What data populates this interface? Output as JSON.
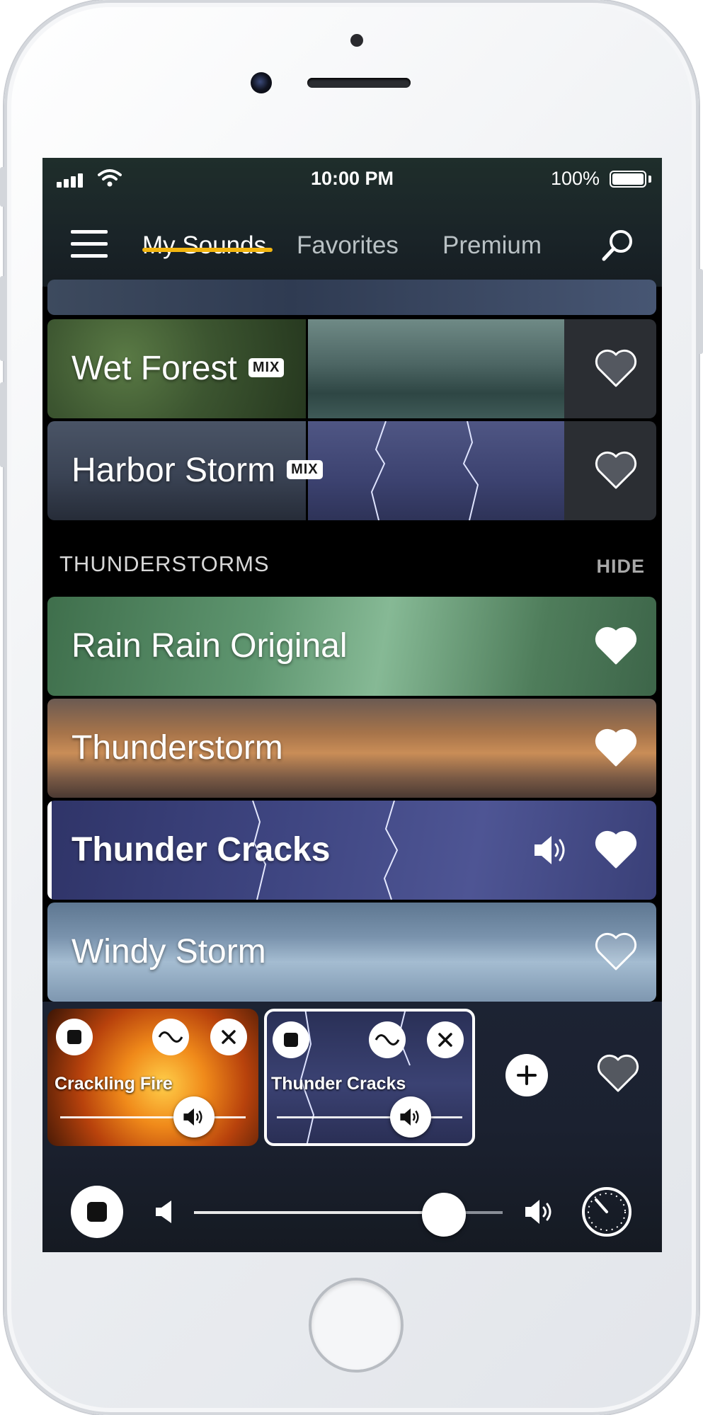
{
  "status": {
    "time": "10:00 PM",
    "battery": "100%"
  },
  "nav": {
    "tabs": [
      {
        "label": "My Sounds",
        "active": true
      },
      {
        "label": "Favorites",
        "active": false
      },
      {
        "label": "Premium",
        "active": false
      }
    ],
    "accent": "#f1b510"
  },
  "mixes": [
    {
      "title": "Wet Forest",
      "badge": "MIX"
    },
    {
      "title": "Harbor Storm",
      "badge": "MIX"
    }
  ],
  "section": {
    "title": "THUNDERSTORMS",
    "action": "HIDE"
  },
  "sounds": [
    {
      "title": "Rain Rain Original",
      "favorite": true,
      "playing": false
    },
    {
      "title": "Thunderstorm",
      "favorite": true,
      "playing": false
    },
    {
      "title": "Thunder Cracks",
      "favorite": true,
      "playing": true
    },
    {
      "title": "Windy Storm",
      "favorite": false,
      "playing": false
    }
  ],
  "mixer": {
    "tracks": [
      {
        "label": "Crackling Fire",
        "volume": 0.72
      },
      {
        "label": "Thunder Cracks",
        "volume": 0.72
      }
    ],
    "master_volume": 0.81
  },
  "icons": [
    "menu-icon",
    "search-icon",
    "heart-icon",
    "speaker-icon",
    "stop-icon",
    "wave-icon",
    "close-icon",
    "plus-icon",
    "volume-low-icon",
    "volume-high-icon",
    "timer-icon"
  ]
}
